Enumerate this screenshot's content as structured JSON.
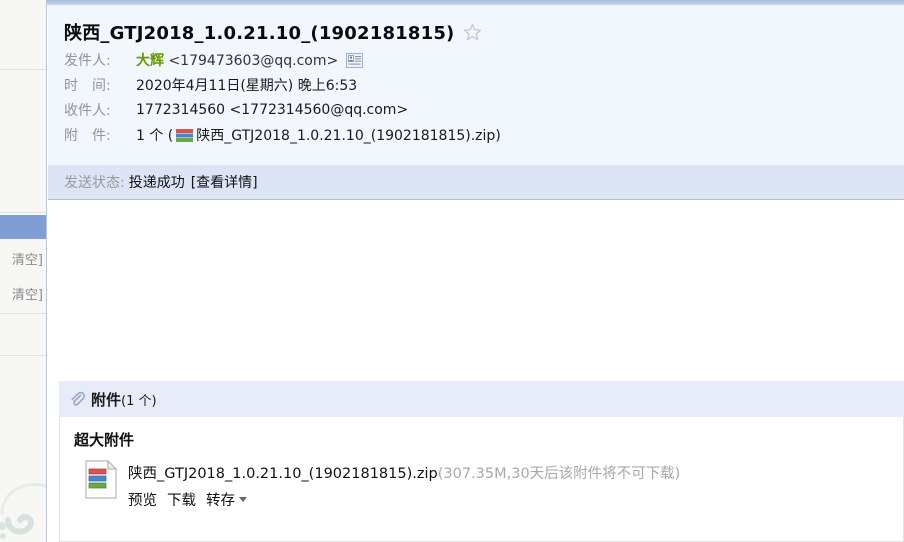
{
  "sidebar": {
    "rows": [
      {
        "label": "清空]"
      },
      {
        "label": "清空]"
      }
    ]
  },
  "mail": {
    "subject": "陕西_GTJ2018_1.0.21.10_(1902181815)",
    "star_icon": "star-outline-icon",
    "meta": [
      {
        "label": "发件人:",
        "sender_name": "大辉",
        "sender_address": "<179473603@qq.com>",
        "icon": "contact-card-icon"
      },
      {
        "label": "时　间:",
        "value": "2020年4月11日(星期六) 晚上6:53"
      },
      {
        "label": "收件人:",
        "value": "1772314560 <1772314560@qq.com>"
      },
      {
        "label": "附　件:",
        "prefix": "1 个 (",
        "icon": "zip-file-icon",
        "filename": "陕西_GTJ2018_1.0.21.10_(1902181815).zip",
        "suffix": ")"
      }
    ]
  },
  "status": {
    "label": "发送状态:",
    "value": "投递成功",
    "detail_link": "[查看详情]"
  },
  "attachments": {
    "header_icon": "paperclip-icon",
    "header_title": "附件",
    "header_count": "(1 个)",
    "group_title": "超大附件",
    "items": [
      {
        "icon": "zip-file-icon",
        "filename": "陕西_GTJ2018_1.0.21.10_(1902181815).zip",
        "fileinfo": "(307.35M,30天后该附件将不可下载)",
        "actions": [
          "预览",
          "下载",
          "转存"
        ],
        "has_dropdown": true
      }
    ]
  },
  "colors": {
    "top_strip": "#a9bcdc",
    "header_bg": "#f2f6fd",
    "status_bg": "#dce4f6",
    "attachment_header_bg": "#e8ecf8",
    "sender_green": "#669900",
    "sidebar_selected": "#7f9fd4",
    "muted_text": "#949494",
    "file_info_gray": "#a8a8a8"
  }
}
